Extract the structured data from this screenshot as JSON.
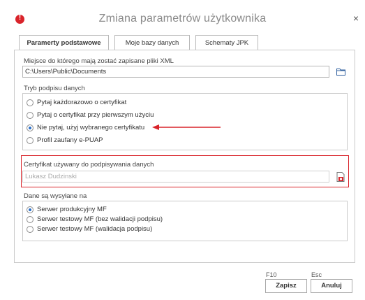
{
  "window": {
    "title": "Zmiana parametrów użytkownika",
    "close_label": "×"
  },
  "tabs": [
    {
      "label": "Paramerty podstawowe",
      "active": true
    },
    {
      "label": "Moje bazy danych",
      "active": false
    },
    {
      "label": "Schematy JPK",
      "active": false
    }
  ],
  "xml_location": {
    "label": "Miejsce do którego mają zostać zapisane pliki XML",
    "value": "C:\\Users\\Public\\Documents",
    "icon": "folder-icon"
  },
  "signing_mode": {
    "label": "Tryb podpisu danych",
    "options": [
      {
        "label": "Pytaj każdorazowo o certyfikat",
        "checked": false
      },
      {
        "label": "Pytaj o certyfikat przy pierwszym użyciu",
        "checked": false
      },
      {
        "label": "Nie pytaj, użyj wybranego certyfikatu",
        "checked": true
      },
      {
        "label": "Profil zaufany e-PUAP",
        "checked": false
      }
    ]
  },
  "certificate": {
    "label": "Certyfikat używany do podpisywania danych",
    "value": "Lukasz Dudzinski",
    "icon": "certificate-icon",
    "highlight_color": "#d9232a"
  },
  "send_to": {
    "label": "Dane są wysyłane na",
    "options": [
      {
        "label": "Serwer produkcyjny MF",
        "checked": true
      },
      {
        "label": "Serwer testowy MF (bez walidacji podpisu)",
        "checked": false
      },
      {
        "label": "Serwer testowy MF (walidacja podpisu)",
        "checked": false
      }
    ]
  },
  "footer": {
    "save_key": "F10",
    "save_label": "Zapisz",
    "cancel_key": "Esc",
    "cancel_label": "Anuluj"
  },
  "colors": {
    "accent_red": "#d9232a",
    "radio_selected": "#2a6fc9"
  }
}
